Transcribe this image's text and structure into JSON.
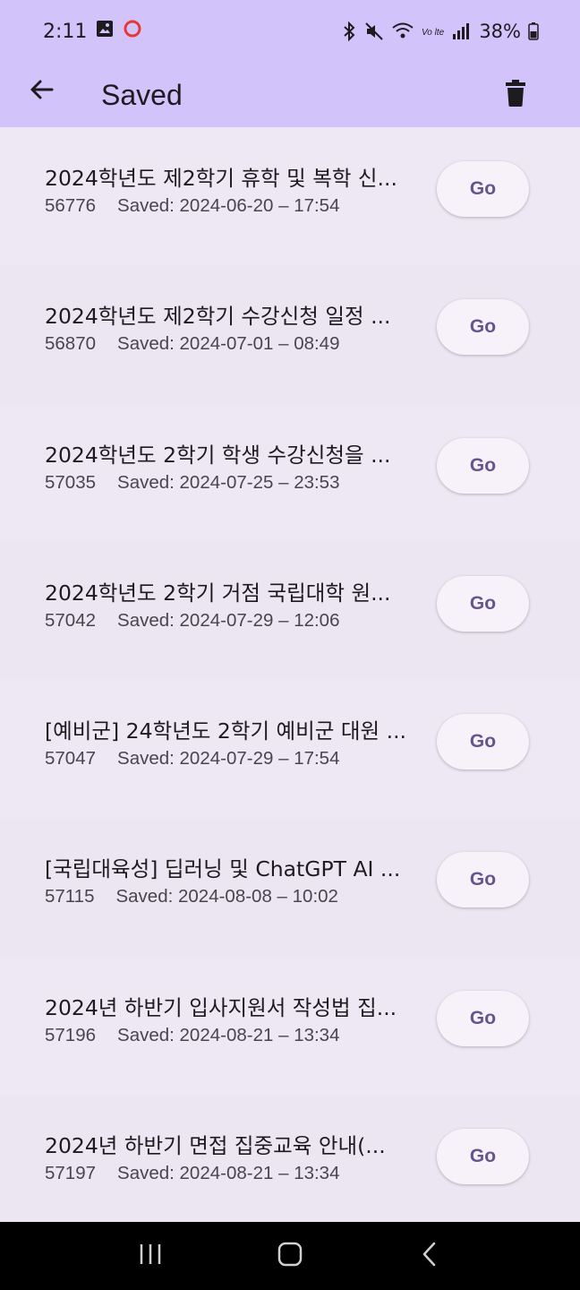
{
  "status_bar": {
    "time": "2:11",
    "battery": "38%",
    "icons": [
      "image-icon",
      "record-icon",
      "bluetooth-icon",
      "mute-icon",
      "wifi-icon",
      "volte-icon",
      "signal-icon",
      "battery-icon"
    ]
  },
  "app_bar": {
    "title": "Saved",
    "back_icon": "arrow-back-icon",
    "delete_icon": "trash-icon"
  },
  "items": [
    {
      "title": "2024학년도  제2학기 휴학 및 복학 신...",
      "id": "56776",
      "saved": "Saved: 2024-06-20 – 17:54",
      "button": "Go"
    },
    {
      "title": "2024학년도 제2학기 수강신청 일정 ...",
      "id": "56870",
      "saved": "Saved: 2024-07-01 – 08:49",
      "button": "Go"
    },
    {
      "title": "2024학년도 2학기 학생 수강신청을 ...",
      "id": "57035",
      "saved": "Saved: 2024-07-25 – 23:53",
      "button": "Go"
    },
    {
      "title": "2024학년도 2학기 거점 국립대학 원...",
      "id": "57042",
      "saved": "Saved: 2024-07-29 – 12:06",
      "button": "Go"
    },
    {
      "title": "[예비군] 24학년도 2학기 예비군 대원 ...",
      "id": "57047",
      "saved": "Saved: 2024-07-29 – 17:54",
      "button": "Go"
    },
    {
      "title": "[국립대육성] 딥러닝 및 ChatGPT AI ...",
      "id": "57115",
      "saved": "Saved: 2024-08-08 – 10:02",
      "button": "Go"
    },
    {
      "title": "2024년 하반기 입사지원서 작성법 집...",
      "id": "57196",
      "saved": "Saved: 2024-08-21 – 13:34",
      "button": "Go"
    },
    {
      "title": "2024년 하반기  면접 집중교육 안내(...",
      "id": "57197",
      "saved": "Saved: 2024-08-21 – 13:34",
      "button": "Go"
    }
  ],
  "nav_bar": {
    "icons": [
      "recents-icon",
      "home-icon",
      "back-icon"
    ]
  },
  "colors": {
    "app_bar": "#d3c3fb",
    "background": "#ece6f2",
    "button_text": "#65558f"
  }
}
